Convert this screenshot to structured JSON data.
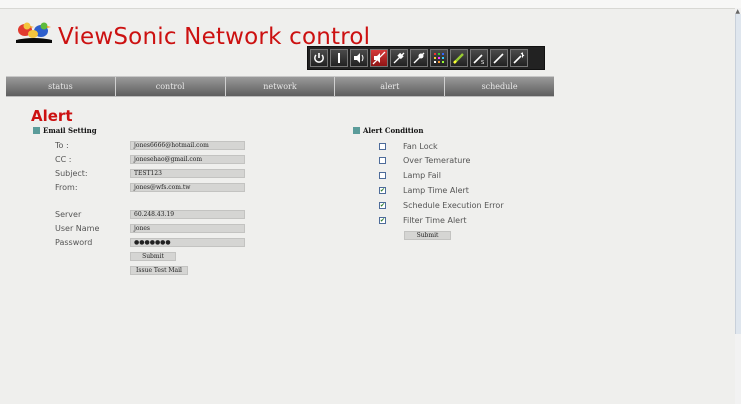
{
  "app": {
    "title": "ViewSonic Network control"
  },
  "nav": {
    "tabs": [
      "status",
      "control",
      "network",
      "alert",
      "schedule"
    ]
  },
  "toolbar": {
    "buttons": [
      "power-icon",
      "info-icon",
      "volume-icon",
      "mute-icon",
      "lamp-icon",
      "lamp-alt-icon",
      "color-grid-icon",
      "brush-icon",
      "pen-s-icon",
      "pen-icon",
      "pen-plus-icon"
    ]
  },
  "page": {
    "title": "Alert"
  },
  "email": {
    "heading": "Email Setting",
    "to_label": "To :",
    "to_value": "jones6666@hotmail.com",
    "cc_label": "CC :",
    "cc_value": "jonesehao@gmail.com",
    "subject_label": "Subject:",
    "subject_value": "TEST123",
    "from_label": "From:",
    "from_value": "jones@wfs.com.tw",
    "server_label": "Server",
    "server_value": "60.248.43.19",
    "username_label": "User Name",
    "username_value": "jones",
    "password_label": "Password",
    "password_value": "●●●●●●●",
    "submit_label": "Submit",
    "test_mail_label": "Issue Test Mail"
  },
  "alert": {
    "heading": "Alert Condition",
    "conditions": [
      {
        "label": "Fan Lock",
        "checked": false
      },
      {
        "label": "Over Temerature",
        "checked": false
      },
      {
        "label": "Lamp Fail",
        "checked": false
      },
      {
        "label": "Lamp Time Alert",
        "checked": true
      },
      {
        "label": "Schedule Execution Error",
        "checked": true
      },
      {
        "label": "Filter Time Alert",
        "checked": true
      }
    ],
    "submit_label": "Submit"
  },
  "colors": {
    "accent": "#cc1111",
    "section_marker": "#5b9c9a"
  }
}
